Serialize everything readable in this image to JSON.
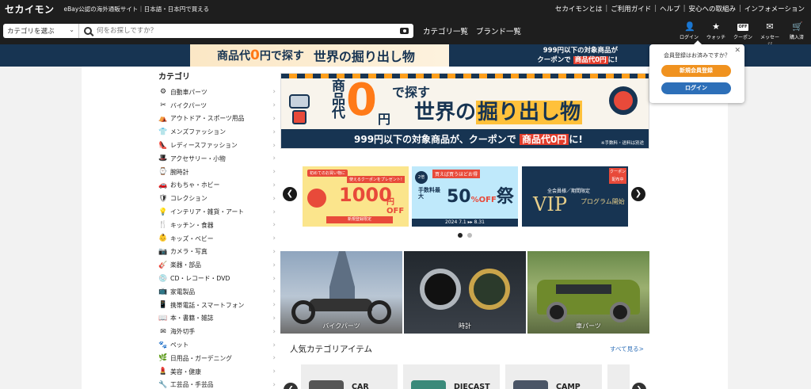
{
  "header": {
    "logo": "セカイモン",
    "tagline": "eBay公認の海外通販サイト｜日本語・日本円で買える",
    "links": [
      "セカイモンとは",
      "ご利用ガイド",
      "ヘルプ",
      "安心への取組み",
      "インフォメーション"
    ]
  },
  "search": {
    "category_label": "カテゴリを選ぶ",
    "placeholder": "何をお探しですか？"
  },
  "nav": {
    "category_list": "カテゴリ一覧",
    "brand_list": "ブランド一覧"
  },
  "icons": [
    {
      "name": "user-icon",
      "label": "ログイン",
      "glyph": "👤"
    },
    {
      "name": "star-icon",
      "label": "ウォッチ",
      "glyph": "★"
    },
    {
      "name": "coupon-icon",
      "label": "クーポン",
      "glyph": "OFF"
    },
    {
      "name": "mail-icon",
      "label": "メッセージ",
      "glyph": "✉"
    },
    {
      "name": "cart-icon",
      "label": "購入済",
      "glyph": "🛒"
    }
  ],
  "strip": {
    "t1a": "商品代",
    "t1b": "0",
    "t1c": "円で探す",
    "t2": "世界の掘り出し物",
    "t3a": "999円以下の対象商品が",
    "t3b": "クーポンで",
    "t3c": "商品代0円",
    "t3d": "に!"
  },
  "popup": {
    "question": "会員登録はお済みですか？",
    "close": "✕",
    "register": "新規会員登録",
    "login": "ログイン"
  },
  "sidebar": {
    "title": "カテゴリ",
    "items": [
      {
        "icon": "wheel-icon",
        "glyph": "⚙",
        "label": "自動車パーツ"
      },
      {
        "icon": "wrench-icon",
        "glyph": "✂",
        "label": "バイクパーツ"
      },
      {
        "icon": "tent-icon",
        "glyph": "⛺",
        "label": "アウトドア・スポーツ用品"
      },
      {
        "icon": "shirt-icon",
        "glyph": "👕",
        "label": "メンズファッション"
      },
      {
        "icon": "heel-icon",
        "glyph": "👠",
        "label": "レディースファッション"
      },
      {
        "icon": "hat-icon",
        "glyph": "🎩",
        "label": "アクセサリー・小物"
      },
      {
        "icon": "watch-icon",
        "glyph": "⌚",
        "label": "腕時計"
      },
      {
        "icon": "car-toy-icon",
        "glyph": "🚗",
        "label": "おもちゃ・ホビー"
      },
      {
        "icon": "shield-icon",
        "glyph": "🛡",
        "label": "コレクション"
      },
      {
        "icon": "lamp-icon",
        "glyph": "💡",
        "label": "インテリア・雑貨・アート"
      },
      {
        "icon": "fork-icon",
        "glyph": "🍴",
        "label": "キッチン・食器"
      },
      {
        "icon": "baby-icon",
        "glyph": "👶",
        "label": "キッズ・ベビー"
      },
      {
        "icon": "camera-icon",
        "glyph": "📷",
        "label": "カメラ・写真"
      },
      {
        "icon": "guitar-icon",
        "glyph": "🎸",
        "label": "楽器・部品"
      },
      {
        "icon": "disc-icon",
        "glyph": "💿",
        "label": "CD・レコード・DVD"
      },
      {
        "icon": "tv-icon",
        "glyph": "📺",
        "label": "家電製品"
      },
      {
        "icon": "phone-icon",
        "glyph": "📱",
        "label": "携帯電話・スマートフォン"
      },
      {
        "icon": "book-icon",
        "glyph": "📖",
        "label": "本・書籍・雑誌"
      },
      {
        "icon": "stamp-icon",
        "glyph": "✉",
        "label": "海外切手"
      },
      {
        "icon": "paw-icon",
        "glyph": "🐾",
        "label": "ペット"
      },
      {
        "icon": "garden-icon",
        "glyph": "🌿",
        "label": "日用品・ガーデニング"
      },
      {
        "icon": "beauty-icon",
        "glyph": "💄",
        "label": "美容・健康"
      },
      {
        "icon": "tool-icon",
        "glyph": "🔧",
        "label": "工芸品・手芸品"
      }
    ]
  },
  "hero": {
    "v1": "商品代",
    "zero": "0",
    "en": "円",
    "desu": "で探す",
    "sekai_a": "世界の",
    "sekai_b": "掘り出し物",
    "sub_a": "999円以下の対象商品が、クーポンで",
    "sub_b": "商品代0円",
    "sub_c": "に!",
    "note": "※手数料・送料は別途"
  },
  "carousel": {
    "prev": "❮",
    "next": "❯",
    "card1": {
      "t1": "初めてのお買い物に",
      "t2": "使えるクーポンをプレゼント!",
      "num": "1000",
      "off": "円OFF",
      "bot": "新規登録限定"
    },
    "card2": {
      "top": "買えば買うほどお得",
      "badge": "2倍",
      "lab": "手数料最大",
      "pct": "50",
      "o": "%OFF",
      "fes": "祭",
      "dates": "2024 7.1 ▸▸ 8.31"
    },
    "card3": {
      "top": "全会員様／期間限定",
      "vip": "VIP",
      "vj": "プログラム開始",
      "tag": "クーポン配布中"
    }
  },
  "photos": [
    {
      "label": "バイクパーツ"
    },
    {
      "label": "時計"
    },
    {
      "label": "車パーツ"
    }
  ],
  "popular": {
    "title": "人気カテゴリアイテム",
    "see_all": "すべて見る>",
    "tiles": [
      "CAR PARTS",
      "DIECAST",
      "CAMP"
    ]
  }
}
